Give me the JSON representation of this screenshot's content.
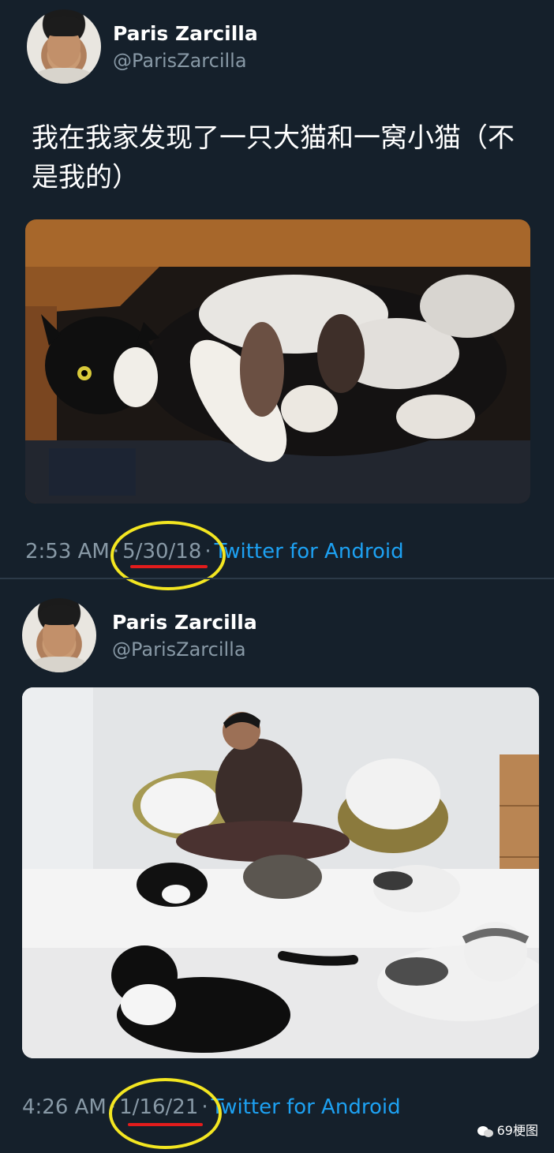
{
  "tweets": [
    {
      "author_name": "Paris Zarcilla",
      "author_handle": "@ParisZarcilla",
      "text": "我在我家发现了一只大猫和一窝小猫（不是我的）",
      "time": "2:53 AM",
      "date": "5/30/18",
      "source": "Twitter for Android",
      "photo_icon": "cat-with-kittens-photo"
    },
    {
      "author_name": "Paris Zarcilla",
      "author_handle": "@ParisZarcilla",
      "time": "4:26 AM",
      "date": "1/16/21",
      "source": "Twitter for Android",
      "photo_icon": "man-with-cats-on-bed-photo"
    }
  ],
  "separator": "·",
  "watermark": "69梗图",
  "colors": {
    "background": "#15202b",
    "secondary_text": "#8899a6",
    "link": "#1da1f2",
    "highlight_circle": "#f3e621",
    "highlight_underline": "#e21c1c"
  }
}
